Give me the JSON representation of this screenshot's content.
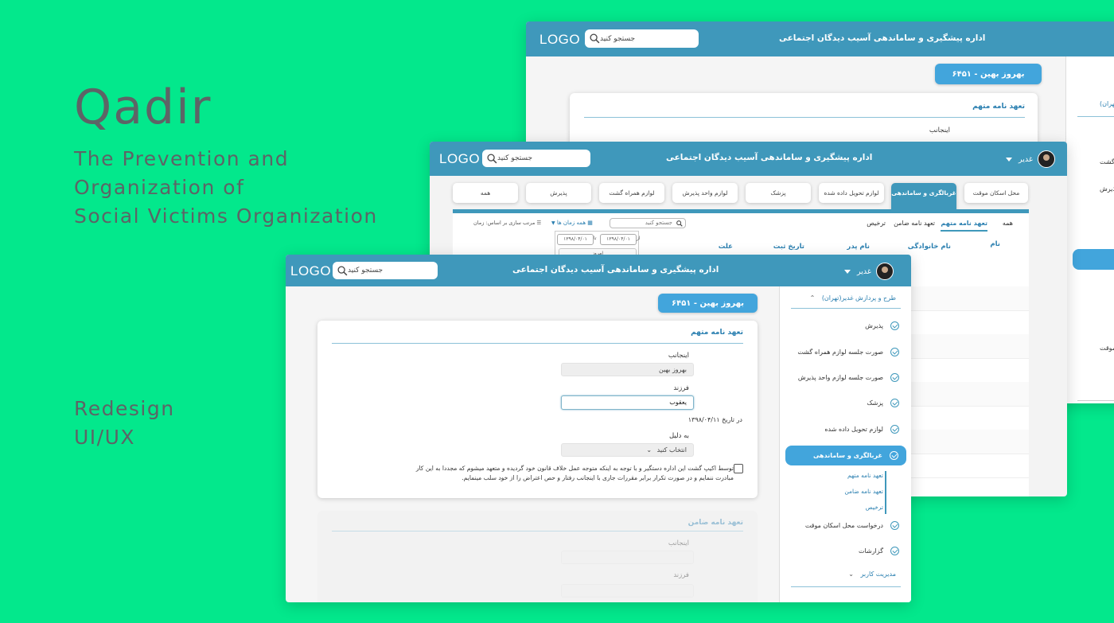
{
  "hero": {
    "title": "Qadir",
    "subtitle_lines": [
      "The Prevention and",
      "Organization of",
      "Social Victims Organization"
    ],
    "tag_lines": [
      "Redesign",
      "UI/UX"
    ]
  },
  "app": {
    "logo": "LOGO",
    "search_placeholder": "جستجو کنید",
    "title": "اداره پیشگیری و ساماندهی آسیب دیدگان اجتماعی",
    "user_name": "غدیر",
    "case_button": "بهروز بهین - ۶۴۵۱"
  },
  "back_window": {
    "section_title": "تعهد نامه متهم",
    "field_label": "اینجانب",
    "side_fragments": [
      "تهران)",
      "همراه گشت",
      "حد پذیرش",
      "ن موقت"
    ]
  },
  "middle_window": {
    "tabs": [
      "محل اسکان موقت",
      "غربالگری و ساماندهی",
      "لوازم تحویل داده شده",
      "پزشک",
      "لوازم واحد پذیرش",
      "لوازم همراه گشت",
      "پذیرش",
      "همه"
    ],
    "subtabs": [
      "همه",
      "تعهد نامه متهم",
      "تعهد نامه ضامن",
      "ترخیص"
    ],
    "list_search_placeholder": "جستجو کنید",
    "filter_all_time": "همه زمان ها",
    "sort_label": "مرتب سازی بر اساس: زمان",
    "date_from": "۱۳۹۸/۰۴/۰۱",
    "date_to": "۱۳۹۸/۰۴/۰۱",
    "date_from_prefix": "از",
    "date_to_prefix": "تا",
    "today_label": "امروز",
    "columns": [
      "نام",
      "نام خانوادگی",
      "نام پدر",
      "تاریخ ثبت",
      "علت"
    ]
  },
  "front_window": {
    "sidebar": {
      "group_title": "طرح و پردازش غدیر(تهران)",
      "items": [
        "پذیرش",
        "صورت جلسه لوازم همراه گشت",
        "صورت جلسه لوازم واحد پذیرش",
        "پزشک",
        "لوازم تحویل داده شده"
      ],
      "active_item": "غربالگری و ساماندهی",
      "subitems": [
        "تعهد نامه متهم",
        "تعهد نامه ضامن",
        "ترخیص"
      ],
      "items_after": [
        "درخواست محل اسکان موقت",
        "گزارشات"
      ],
      "footer_group": "مدیریت کاربر"
    },
    "form": {
      "title": "تعهد نامه متهم",
      "label_name": "اینجانب",
      "value_name": "بهروز بهین",
      "label_child": "فرزند",
      "value_child": "یعقوب",
      "date_text": "در تاریخ ۱۳۹۸/۰۴/۱۱",
      "label_reason": "به دلیل",
      "reason_select": "انتخاب کنید",
      "agreement_line1": "توسط اکیپ گشت این اداره دستگیر و با توجه به اینکه متوجه عمل خلاف قانون خود گردیده و متعهد میشوم که مجددا به این کار",
      "agreement_line2": "مبادرت ننمایم و در صورت تکرار برابر مقررات جاری با اینجانب رفتار و حص اعتراض را از خود سلب مینمایم."
    },
    "form2": {
      "title": "تعهد نامه ضامن",
      "label_name": "اینجانب",
      "label_child": "فرزند"
    }
  },
  "colors": {
    "background": "#03e88c",
    "topbar": "#3f98bb",
    "accent": "#42a5dc",
    "hero_text": "#5d6466"
  }
}
